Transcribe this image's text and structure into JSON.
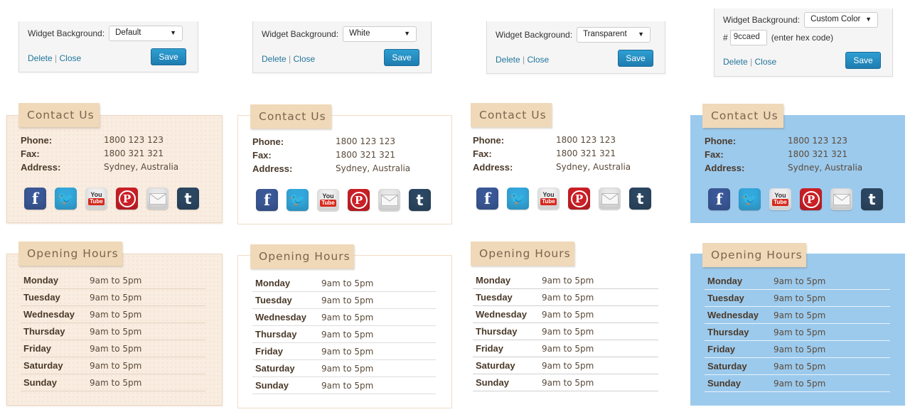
{
  "colors": {
    "pattern_bg": "#f9ece0",
    "white_bg": "#ffffff",
    "custom_bg": "#9ccaed",
    "tag_bg": "#f0d9b8",
    "save_button": "#2e9fd2",
    "link": "#21759b"
  },
  "settings": [
    {
      "label": "Widget Background:",
      "selected": "Default",
      "delete": "Delete",
      "sep": "|",
      "close": "Close",
      "save": "Save"
    },
    {
      "label": "Widget Background:",
      "selected": "White",
      "delete": "Delete",
      "sep": "|",
      "close": "Close",
      "save": "Save"
    },
    {
      "label": "Widget Background:",
      "selected": "Transparent",
      "delete": "Delete",
      "sep": "|",
      "close": "Close",
      "save": "Save"
    },
    {
      "label": "Widget Background:",
      "selected": "Custom Color",
      "hash": "#",
      "hex_value": "9ccaed",
      "hex_hint": "(enter hex code)",
      "delete": "Delete",
      "sep": "|",
      "close": "Close",
      "save": "Save"
    }
  ],
  "contact": {
    "title": "Contact Us",
    "phone_label": "Phone:",
    "phone": "1800 123 123",
    "fax_label": "Fax:",
    "fax": "1800 321 321",
    "address_label": "Address:",
    "address": "Sydney, Australia",
    "social_icons": [
      "facebook-icon",
      "twitter-icon",
      "youtube-icon",
      "pinterest-icon",
      "email-icon",
      "tumblr-icon"
    ],
    "youtube_you": "You",
    "youtube_tube": "Tube"
  },
  "hours": {
    "title": "Opening Hours",
    "rows": [
      {
        "day": "Monday",
        "time": "9am to 5pm"
      },
      {
        "day": "Tuesday",
        "time": "9am to 5pm"
      },
      {
        "day": "Wednesday",
        "time": "9am to 5pm"
      },
      {
        "day": "Thursday",
        "time": "9am to 5pm"
      },
      {
        "day": "Friday",
        "time": "9am to 5pm"
      },
      {
        "day": "Saturday",
        "time": "9am to 5pm"
      },
      {
        "day": "Sunday",
        "time": "9am to 5pm"
      }
    ]
  }
}
